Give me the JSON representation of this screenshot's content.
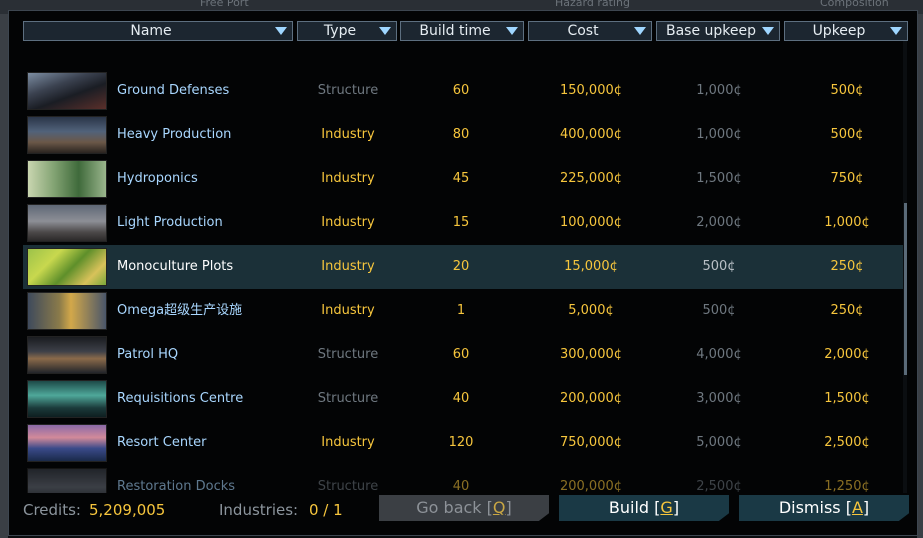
{
  "background": {
    "left_text": "Free Port",
    "mid_text": "Hazard rating",
    "right_text": "Composition"
  },
  "columns": [
    {
      "key": "name",
      "label": "Name"
    },
    {
      "key": "type",
      "label": "Type"
    },
    {
      "key": "build_time",
      "label": "Build time"
    },
    {
      "key": "cost",
      "label": "Cost"
    },
    {
      "key": "base_upkeep",
      "label": "Base upkeep"
    },
    {
      "key": "upkeep",
      "label": "Upkeep"
    }
  ],
  "rows": [
    {
      "name": "Ground Defenses",
      "type": "Structure",
      "build_time": "60",
      "cost": "150,000¢",
      "base_upkeep": "1,000¢",
      "upkeep": "500¢"
    },
    {
      "name": "Heavy Production",
      "type": "Industry",
      "build_time": "80",
      "cost": "400,000¢",
      "base_upkeep": "1,000¢",
      "upkeep": "500¢"
    },
    {
      "name": "Hydroponics",
      "type": "Industry",
      "build_time": "45",
      "cost": "225,000¢",
      "base_upkeep": "1,500¢",
      "upkeep": "750¢"
    },
    {
      "name": "Light Production",
      "type": "Industry",
      "build_time": "15",
      "cost": "100,000¢",
      "base_upkeep": "2,000¢",
      "upkeep": "1,000¢"
    },
    {
      "name": "Monoculture Plots",
      "type": "Industry",
      "build_time": "20",
      "cost": "15,000¢",
      "base_upkeep": "500¢",
      "upkeep": "250¢",
      "selected": true
    },
    {
      "name": "Omega超级生产设施",
      "type": "Industry",
      "build_time": "1",
      "cost": "5,000¢",
      "base_upkeep": "500¢",
      "upkeep": "250¢"
    },
    {
      "name": "Patrol HQ",
      "type": "Structure",
      "build_time": "60",
      "cost": "300,000¢",
      "base_upkeep": "4,000¢",
      "upkeep": "2,000¢"
    },
    {
      "name": "Requisitions Centre",
      "type": "Structure",
      "build_time": "40",
      "cost": "200,000¢",
      "base_upkeep": "3,000¢",
      "upkeep": "1,500¢"
    },
    {
      "name": "Resort Center",
      "type": "Industry",
      "build_time": "120",
      "cost": "750,000¢",
      "base_upkeep": "5,000¢",
      "upkeep": "2,500¢"
    },
    {
      "name": "Restoration Docks",
      "type": "Structure",
      "build_time": "40",
      "cost": "200,000¢",
      "base_upkeep": "2,500¢",
      "upkeep": "1,250¢"
    }
  ],
  "footer": {
    "credits_label": "Credits:",
    "credits_value": "5,209,005",
    "industries_label": "Industries:",
    "industries_value": "0 / 1",
    "go_back": {
      "label": "Go back [",
      "key": "Q",
      "end": "]"
    },
    "build": {
      "label": "Build [",
      "key": "G",
      "end": "]"
    },
    "dismiss": {
      "label": "Dismiss [",
      "key": "A",
      "end": "]"
    }
  },
  "colors": {
    "accent": "#f7c63d",
    "header_arrow": "#9fd6ff",
    "selected_row": "#1b3038",
    "button": "#1a3945"
  }
}
